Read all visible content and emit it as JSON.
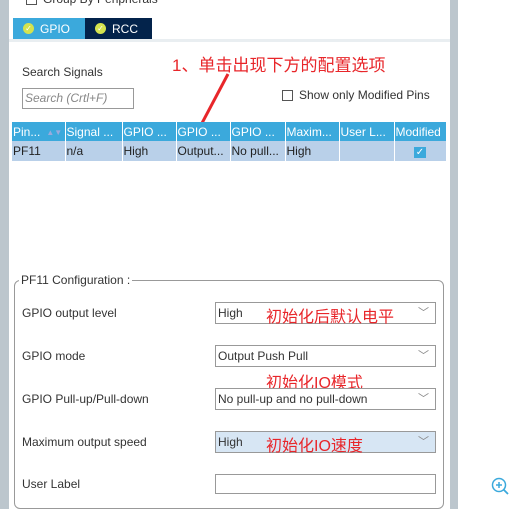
{
  "header": {
    "group_by_label": "Group By Peripherals"
  },
  "tabs": [
    {
      "label": "GPIO",
      "active": true
    },
    {
      "label": "RCC",
      "active": false
    }
  ],
  "search": {
    "label": "Search Signals",
    "placeholder": "Search (Crtl+F)",
    "value": ""
  },
  "show_modified_label": "Show only Modified Pins",
  "annotations": {
    "step1": "1、单击出现下方的配置选项",
    "output_level": "初始化后默认电平",
    "mode": "初始化IO模式",
    "speed": "初始化IO速度"
  },
  "pin_table": {
    "columns": [
      "Pin...",
      "Signal ...",
      "GPIO ...",
      "GPIO ...",
      "GPIO ...",
      "Maxim...",
      "User L...",
      "Modified"
    ],
    "rows": [
      {
        "cells": [
          "PF11",
          "n/a",
          "High",
          "Output...",
          "No pull...",
          "High",
          "",
          ""
        ],
        "modified": true
      }
    ]
  },
  "config": {
    "title": "PF11 Configuration :",
    "fields": [
      {
        "label": "GPIO output level",
        "value": "High"
      },
      {
        "label": "GPIO mode",
        "value": "Output Push Pull"
      },
      {
        "label": "GPIO Pull-up/Pull-down",
        "value": "No pull-up and no pull-down"
      },
      {
        "label": "Maximum output speed",
        "value": "High"
      },
      {
        "label": "User Label",
        "value": ""
      }
    ]
  },
  "colors": {
    "accent": "#3ba9dc",
    "dark_tab": "#03234b",
    "selected_row": "#b9d0e9",
    "annotation": "#e8262a"
  }
}
